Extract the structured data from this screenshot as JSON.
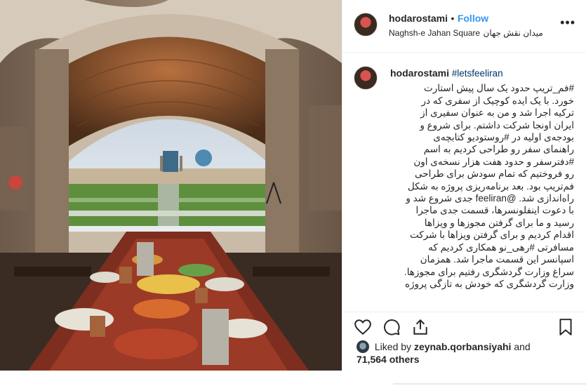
{
  "post": {
    "username": "hodarostami",
    "follow_label": "Follow",
    "dot": "•",
    "location_latin": "Naghsh-e Jahan Square",
    "location_farsi": "میدان نقش جهان",
    "more_icon": "more-horizontal-icon",
    "caption": {
      "username": "hodarostami",
      "hashtag": "#letsfeeliran",
      "lines": [
        "#فم_تریپ حدود یک سال پیش استارت",
        "خورد. با یک ایده کوچیک از سفری که در",
        "ترکیه اجرا شد و من به عنوان سفیری از",
        "ایران اونجا شرکت داشتم. برای شروع و",
        "بودجه‌ی اولیه در #روستودیو کتابچه‌ی",
        "راهنمای سفر رو طراحی کردیم به اسم",
        "#دفترسفر و حدود هفت هزار نسخه‌ی اون",
        "رو فروختیم که تمام سودش برای طراحی",
        "فم‌تریپ بود. بعد برنامه‌ریزی پروژه به شکل",
        "راه‌اندازی شد. @feeliran جدی شروع شد و",
        "با دعوت اینفلونسرها، قسمت جدی ماجرا",
        "رسید و ما برای گرفتن مجوزها و ویزاها",
        "اقدام کردیم و برای گرفتن ویزاها با شرکت",
        "مسافرتی #رهی_نو همکاری کردیم که",
        "اسپانسر این قسمت ماجرا شد. همزمان",
        "سراغ وزارت گردشگری رفتیم برای مجوزها.",
        "وزارت گردشگری که خودش به تازگی پروژه"
      ]
    },
    "liked_by_prefix": "Liked by",
    "liked_by_user": "zeynab.qorbansiyahi",
    "liked_by_and": "and",
    "likes_count": "71,564 others",
    "colors": {
      "link": "#3897f0",
      "hashtag": "#003569",
      "text": "#262626"
    }
  }
}
